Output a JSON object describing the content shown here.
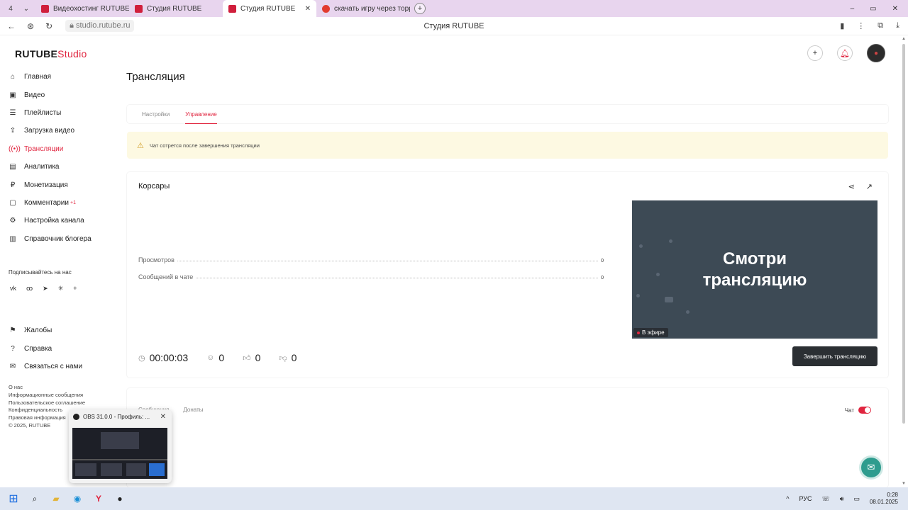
{
  "browser": {
    "tab_counter": "4",
    "tabs": [
      {
        "label": "Видеохостинг RUTUBE. С",
        "color": "#d01f3c"
      },
      {
        "label": "Студия RUTUBE",
        "color": "#d01f3c"
      },
      {
        "label": "Студия RUTUBE",
        "color": "#d01f3c"
      },
      {
        "label": "скачать игру через торр",
        "color": "#e23b2e"
      }
    ],
    "url": "studio.rutube.ru",
    "page_title": "Студия RUTUBE"
  },
  "header": {
    "logo_main": "RUTUBE",
    "logo_studio": "Studio"
  },
  "sidebar": {
    "items": [
      {
        "label": "Главная",
        "icon": "home-icon"
      },
      {
        "label": "Видео",
        "icon": "video-icon"
      },
      {
        "label": "Плейлисты",
        "icon": "playlist-icon"
      },
      {
        "label": "Загрузка видео",
        "icon": "upload-icon"
      },
      {
        "label": "Трансляции",
        "icon": "broadcast-icon"
      },
      {
        "label": "Аналитика",
        "icon": "analytics-icon"
      },
      {
        "label": "Монетизация",
        "icon": "monetization-icon"
      },
      {
        "label": "Комментарии",
        "icon": "comments-icon",
        "badge": "+1"
      },
      {
        "label": "Настройка канала",
        "icon": "gear-icon"
      },
      {
        "label": "Справочник блогера",
        "icon": "book-icon"
      }
    ],
    "follow_label": "Подписывайтесь на нас",
    "socials": [
      "vk",
      "ok",
      "tg",
      "dzen",
      "+"
    ],
    "bottom_items": [
      {
        "label": "Жалобы",
        "icon": "flag-icon"
      },
      {
        "label": "Справка",
        "icon": "help-icon"
      },
      {
        "label": "Связаться с нами",
        "icon": "mail-icon"
      }
    ],
    "footer_links": [
      "О нас",
      "Информационные сообщения",
      "Пользовательское соглашение",
      "Конфиденциальность",
      "Правовая информация",
      "© 2025, RUTUBE"
    ]
  },
  "main": {
    "title": "Трансляция",
    "tabs": [
      "Настройки",
      "Управление"
    ],
    "warning": "Чат сотрется после завершения трансляции",
    "stream": {
      "name": "Корсары",
      "stats": [
        {
          "label": "Просмотров",
          "value": "0"
        },
        {
          "label": "Сообщений в чате",
          "value": "0"
        }
      ],
      "duration": "00:00:03",
      "viewers": "0",
      "likes": "0",
      "dislikes": "0",
      "preview_text_1": "Смотри",
      "preview_text_2": "трансляцию",
      "live_label": "В эфире",
      "end_button": "Завершить трансляцию"
    },
    "chat": {
      "tabs": [
        "Сообщения",
        "Донаты"
      ],
      "toggle_label": "Чат",
      "toggle_on": true
    }
  },
  "thumbnail": {
    "title": "OBS 31.0.0 - Профиль: ..."
  },
  "taskbar": {
    "lang": "РУС",
    "time": "0:28",
    "date": "08.01.2025"
  }
}
